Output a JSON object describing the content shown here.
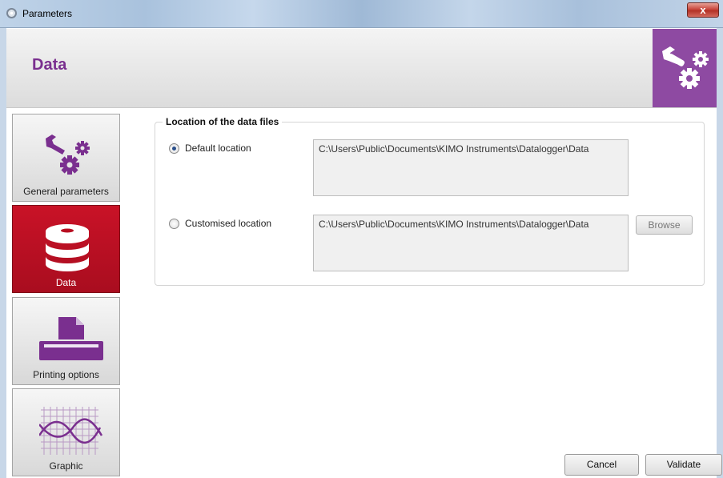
{
  "window": {
    "title": "Parameters",
    "close_glyph": "x"
  },
  "header": {
    "title": "Data",
    "badge_icon": "wrench-gears-icon",
    "accent": "#8e4aa2"
  },
  "sidebar": {
    "items": [
      {
        "label": "General parameters",
        "icon": "wrench-gears-icon",
        "active": false
      },
      {
        "label": "Data",
        "icon": "database-icon",
        "active": true
      },
      {
        "label": "Printing options",
        "icon": "printer-icon",
        "active": false
      },
      {
        "label": "Graphic",
        "icon": "graph-icon",
        "active": false
      }
    ],
    "active_color": "#c01023"
  },
  "location_group": {
    "title": "Location of the data files",
    "default": {
      "label": "Default location",
      "checked": true,
      "path": "C:\\Users\\Public\\Documents\\KIMO Instruments\\Datalogger\\Data"
    },
    "custom": {
      "label": "Customised location",
      "checked": false,
      "path": "C:\\Users\\Public\\Documents\\KIMO Instruments\\Datalogger\\Data",
      "browse_label": "Browse"
    }
  },
  "footer": {
    "cancel_label": "Cancel",
    "validate_label": "Validate"
  }
}
